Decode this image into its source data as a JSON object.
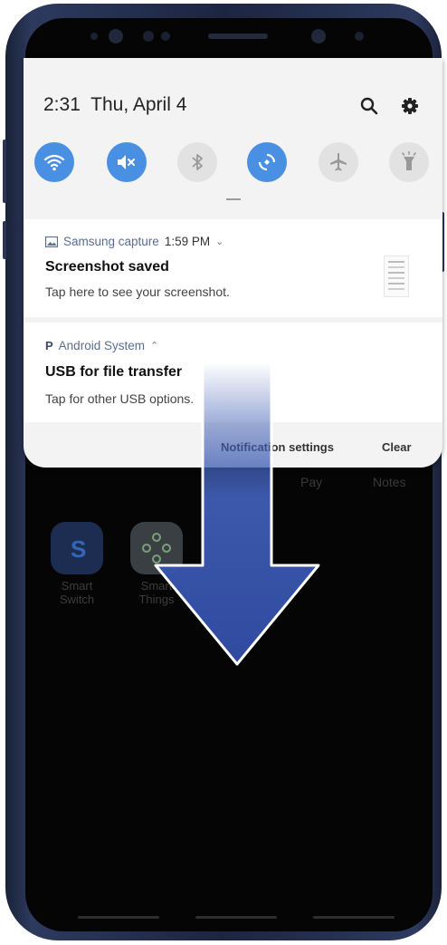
{
  "status": {
    "time": "2:31",
    "date": "Thu, April 4"
  },
  "quick_settings": [
    {
      "name": "wifi",
      "state": "on"
    },
    {
      "name": "sound-muted",
      "state": "on"
    },
    {
      "name": "bluetooth",
      "state": "off"
    },
    {
      "name": "auto-rotate",
      "state": "on"
    },
    {
      "name": "airplane-mode",
      "state": "off"
    },
    {
      "name": "flashlight",
      "state": "off"
    }
  ],
  "notifications": [
    {
      "app": "Samsung capture",
      "time": "1:59 PM",
      "title": "Screenshot saved",
      "body": "Tap here to see your screenshot."
    },
    {
      "app": "Android System",
      "title": "USB for file transfer",
      "body": "Tap for other USB options."
    }
  ],
  "footer": {
    "settings_label": "Notification settings",
    "clear_label": "Clear"
  },
  "home": {
    "dock_labels": [
      "Pay",
      "Notes"
    ],
    "apps": [
      {
        "line1": "Smart",
        "line2": "Switch"
      },
      {
        "line1": "Smart",
        "line2": "Things"
      }
    ]
  },
  "colors": {
    "accent": "#4a90e2",
    "tile_off": "#e2e2e2",
    "arrow": "#3f5db3"
  }
}
